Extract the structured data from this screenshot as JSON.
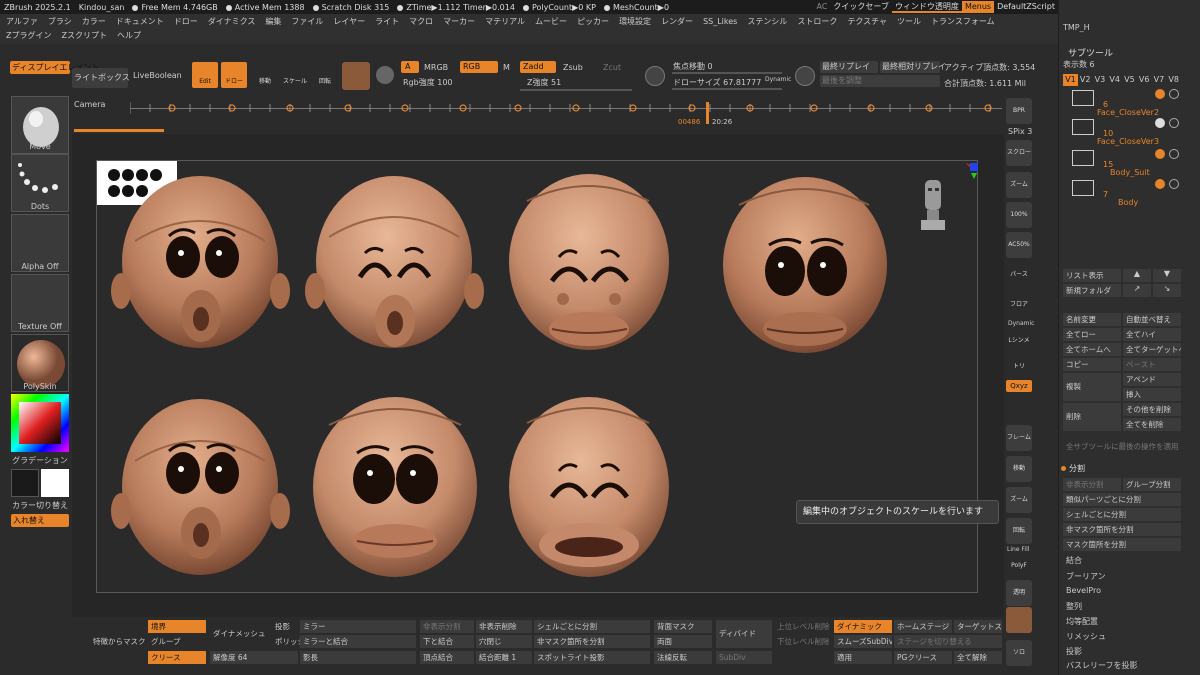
{
  "titlebar": {
    "app": "ZBrush 2025.2.1",
    "file": "Kindou_san",
    "stats": [
      "Free Mem 4.746GB",
      "Active Mem 1388",
      "Scratch Disk 315",
      "ZTime▶1.112 Timer▶0.014",
      "PolyCount▶0 KP",
      "MeshCount▶0"
    ],
    "ac": "AC",
    "quicksave": "クイックセーブ",
    "transparency": "ウィンドウ透明度",
    "menus": "Menus",
    "script": "DefaultZScript"
  },
  "menu": [
    "アルファ",
    "ブラシ",
    "カラー",
    "ドキュメント",
    "ドロー",
    "ダイナミクス",
    "編集",
    "ファイル",
    "レイヤー",
    "ライト",
    "マクロ",
    "マーカー",
    "マテリアル",
    "ムービー",
    "ピッカー",
    "環境設定",
    "レンダー",
    "SS_Likes",
    "ステンシル",
    "ストローク",
    "テクスチャ",
    "ツール",
    "トランスフォーム",
    "Zプラグイン",
    "Zスクリプト",
    "ヘルプ"
  ],
  "toolbar": {
    "display_elements": "ディスプレイエレメント",
    "lightbox": "ライトボックス",
    "liveboolean": "LiveBoolean",
    "edit": "Edit",
    "draw": "ドロー",
    "move": "移動",
    "scale": "スケール",
    "rotate": "回転",
    "a": "A",
    "mrgb": "MRGB",
    "rgb": "RGB",
    "m": "M",
    "zadd": "Zadd",
    "zsub": "Zsub",
    "zcut": "Zcut",
    "rgb_intensity": "Rgb強度 100",
    "z_intensity": "Z強度 51",
    "focal": "焦点移動 0",
    "draw_size": "ドローサイズ 67.81777",
    "dynamic": "Dynamic",
    "replay": "最終リプレイ",
    "replay_rel": "最終相対リプレイ",
    "adjust": "最後を調整",
    "active_points": "アクティブ頂点数: 3,554",
    "total_points": "合計頂点数: 1.611 Mil"
  },
  "left": {
    "brush": "Move",
    "stroke": "Dots",
    "alpha": "Alpha Off",
    "texture": "Texture Off",
    "material": "PolySkin",
    "gradient": "グラデーション",
    "switch_color": "カラー切り替え",
    "swap": "入れ替え"
  },
  "timeline": {
    "label": "Camera",
    "time": "00486",
    "clock": "20:26"
  },
  "right": {
    "bpr": "BPR",
    "spix": "SPix 3",
    "scroll": "スクロール",
    "zoom2d": "ズーム2D",
    "p100": "100%",
    "ac50": "AC50%",
    "persp": "パース",
    "floor": "フロア",
    "dynamic": "Dynamic",
    "lsym": "Lシンメトリ",
    "xyz": "Qxyz",
    "frame": "フレーム",
    "move": "移動",
    "zoom3d": "ズーム3D",
    "rotate": "回転",
    "linefill": "Line Fill",
    "polyf": "PolyF",
    "transp": "透明",
    "solo": "ソロ"
  },
  "tooltip": "編集中のオブジェクトのスケールを行います",
  "panel": {
    "title": "サブツール",
    "tmp": "TMP_H",
    "display_count": "表示数 6",
    "versions": [
      "V1",
      "V2",
      "V3",
      "V4",
      "V5",
      "V6",
      "V7",
      "V8"
    ],
    "subtools": [
      {
        "num": "6",
        "name": "Face_CloseVer2"
      },
      {
        "num": "10",
        "name": "Face_CloseVer3"
      },
      {
        "num": "15",
        "name": "Body_Suit"
      },
      {
        "num": "7",
        "name": "Body"
      }
    ],
    "list": "リスト表示",
    "new_folder": "新規フォルダ",
    "rename": "名前変更",
    "auto_sort": "自動並べ替え",
    "all_low": "全てロー",
    "all_high": "全てハイ",
    "all_home": "全てホームへ",
    "all_target": "全てターゲットへ",
    "copy": "コピー",
    "paste": "ペースト",
    "duplicate": "複製",
    "append": "アペンド",
    "insert": "挿入",
    "delete": "削除",
    "delete_other": "その他を削除",
    "delete_all": "全てを削除",
    "apply_last": "全サブツールに最後の操作を適用",
    "split": "分割",
    "split_hidden": "非表示分割",
    "split_groups": "グループ分割",
    "split_similar": "類似パーツごとに分割",
    "split_shell": "シェルごとに分割",
    "split_unmasked": "非マスク箇所を分割",
    "split_masked": "マスク箇所を分割",
    "merge": "結合",
    "boolean": "ブーリアン",
    "bevelpro": "BevelPro",
    "align": "整列",
    "distribute": "均等配置",
    "remesh": "リメッシュ",
    "project": "投影",
    "basrelief": "バスレリーフを投影"
  },
  "bottom": {
    "border": "境界",
    "group": "グループ",
    "crease": "クリース",
    "feature_mask": "特徴からマスク",
    "dynamesh": "ダイナメッシュ",
    "resolution": "解像度 64",
    "project": "投影",
    "polish": "ポリッシ",
    "mirror": "ミラー",
    "mirror_weld": "ミラーと結合",
    "shadow": "影長",
    "hidden_split": "非表示分割",
    "hidden_delete": "非表示削除",
    "shell_split": "シェルごとに分割",
    "lower_merge": "下と結合",
    "close_holes": "穴閉じ",
    "unmasked_split": "非マスク箇所を分割",
    "vertex_merge": "頂点結合",
    "merge_dist": "結合距離 1",
    "spotlight": "スポットライト投影",
    "backface_mask": "背面マスク",
    "double": "両面",
    "flip_normals": "法線反転",
    "divide": "ディバイド",
    "subdiv": "SubDiv",
    "upper_del": "上位レベル削除",
    "lower_del": "下位レベル削除",
    "dynamic": "ダイナミック",
    "smooth_subdiv": "スムーズSubDiv",
    "apply": "適用",
    "homestage": "ホームステージ",
    "targetstage": "ターゲットス",
    "switch_stage": "ステージを切り替える",
    "pg_crease": "PGクリース",
    "uncrease_all": "全て解除"
  },
  "colors": {
    "accent": "#e8852a",
    "skin": "#c9906e",
    "bg": "#262626"
  }
}
